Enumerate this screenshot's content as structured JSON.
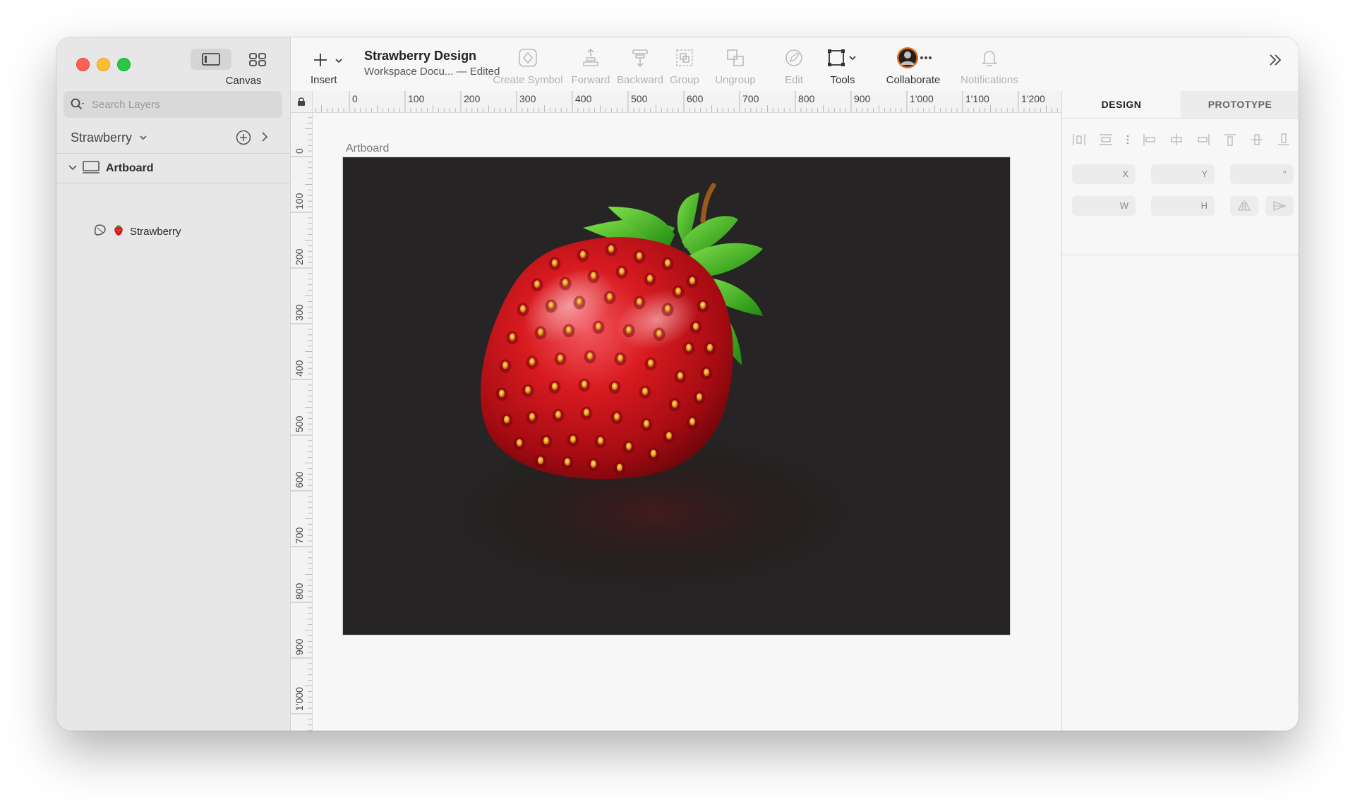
{
  "sidebar": {
    "canvas_label": "Canvas",
    "search_placeholder": "Search Layers",
    "page_name": "Strawberry",
    "layers": {
      "artboard": "Artboard",
      "strawberry": "Strawberry"
    }
  },
  "toolbar": {
    "insert": "Insert",
    "doc_title": "Strawberry Design",
    "doc_subtitle": "Workspace Docu...  — Edited",
    "create_symbol": "Create Symbol",
    "forward": "Forward",
    "backward": "Backward",
    "group": "Group",
    "ungroup": "Ungroup",
    "edit": "Edit",
    "tools": "Tools",
    "collaborate": "Collaborate",
    "notifications": "Notifications"
  },
  "rulers": {
    "horizontal": [
      "0",
      "100",
      "200",
      "300",
      "400",
      "500",
      "600",
      "700",
      "800",
      "900",
      "1'000",
      "1'100",
      "1'200"
    ],
    "vertical": [
      "0",
      "100",
      "200",
      "300",
      "400",
      "500",
      "600",
      "700",
      "800",
      "900",
      "1'000"
    ]
  },
  "canvas": {
    "artboard_title": "Artboard"
  },
  "inspector": {
    "tab_design": "DESIGN",
    "tab_prototype": "PROTOTYPE",
    "fields": {
      "x": "X",
      "y": "Y",
      "rotation": "°",
      "w": "W",
      "h": "H"
    }
  },
  "colors": {
    "accent_close": "#fe5f57",
    "accent_min": "#febc2e",
    "accent_max": "#28c840",
    "artboard_bg": "#262424",
    "strawberry_red": "#d0101a",
    "leaf_green": "#3fae1e"
  }
}
